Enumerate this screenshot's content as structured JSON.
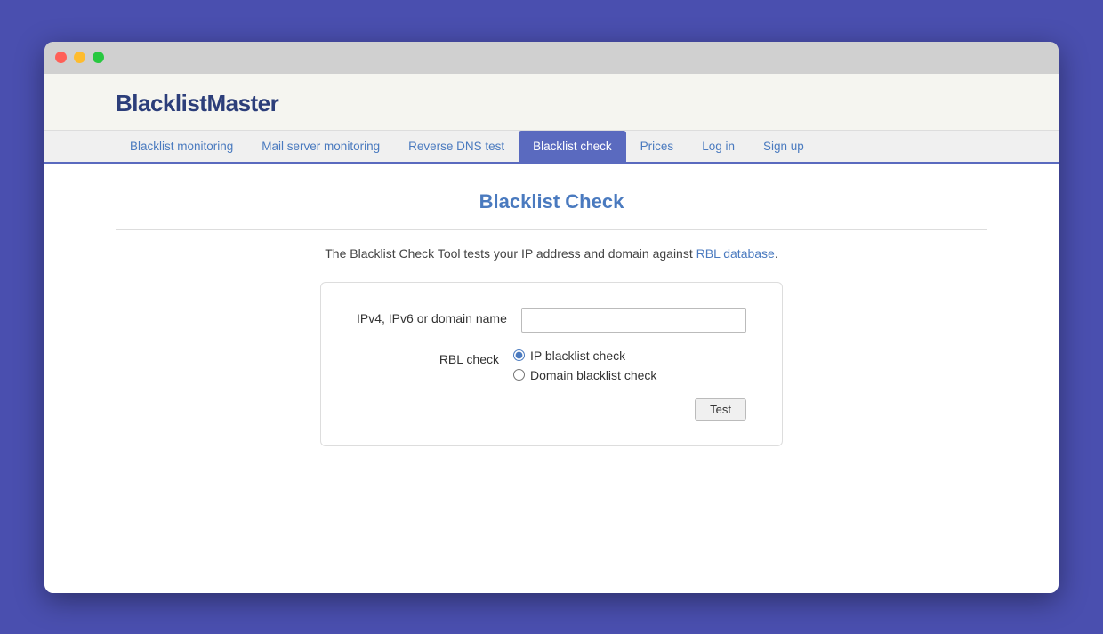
{
  "window": {
    "titlebar": {
      "traffic_lights": [
        "red",
        "yellow",
        "green"
      ]
    }
  },
  "header": {
    "logo": "BlacklistMaster"
  },
  "nav": {
    "items": [
      {
        "label": "Blacklist monitoring",
        "active": false
      },
      {
        "label": "Mail server monitoring",
        "active": false
      },
      {
        "label": "Reverse DNS test",
        "active": false
      },
      {
        "label": "Blacklist check",
        "active": true
      },
      {
        "label": "Prices",
        "active": false
      },
      {
        "label": "Log in",
        "active": false
      },
      {
        "label": "Sign up",
        "active": false
      }
    ]
  },
  "main": {
    "page_title": "Blacklist Check",
    "description_before": "The Blacklist Check Tool tests your IP address and domain against ",
    "rbl_link_text": "RBL database",
    "description_after": ".",
    "form": {
      "ip_label": "IPv4, IPv6 or domain name",
      "ip_placeholder": "",
      "rbl_label": "RBL check",
      "radio_options": [
        {
          "label": "IP blacklist check",
          "checked": true
        },
        {
          "label": "Domain blacklist check",
          "checked": false
        }
      ],
      "test_button": "Test"
    }
  }
}
